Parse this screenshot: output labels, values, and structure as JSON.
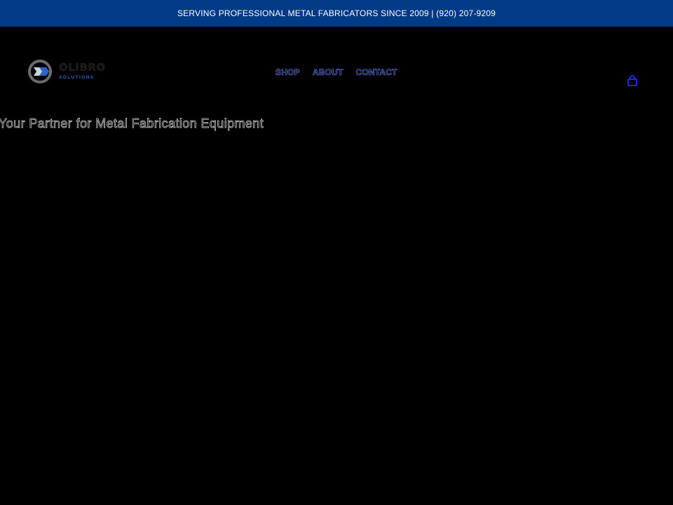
{
  "announcement": {
    "text": "SERVING PROFESSIONAL METAL FABRICATORS SINCE 2009 | (920) 207-9209"
  },
  "logo": {
    "name": "OLIBRO",
    "sub": "SOLUTIONS"
  },
  "nav": {
    "items": [
      {
        "label": "SHOP"
      },
      {
        "label": "ABOUT"
      },
      {
        "label": "CONTACT"
      }
    ]
  },
  "hero": {
    "title": "Your Partner for Metal Fabrication Equipment"
  },
  "colors": {
    "announcement_bg": "#023a85",
    "page_bg": "#000000",
    "nav_outline": "#6c86ff",
    "cart_icon": "#1f2cff",
    "logo_accent": "#2f63c9"
  },
  "icons": {
    "cart": "shopping-bag-icon"
  }
}
